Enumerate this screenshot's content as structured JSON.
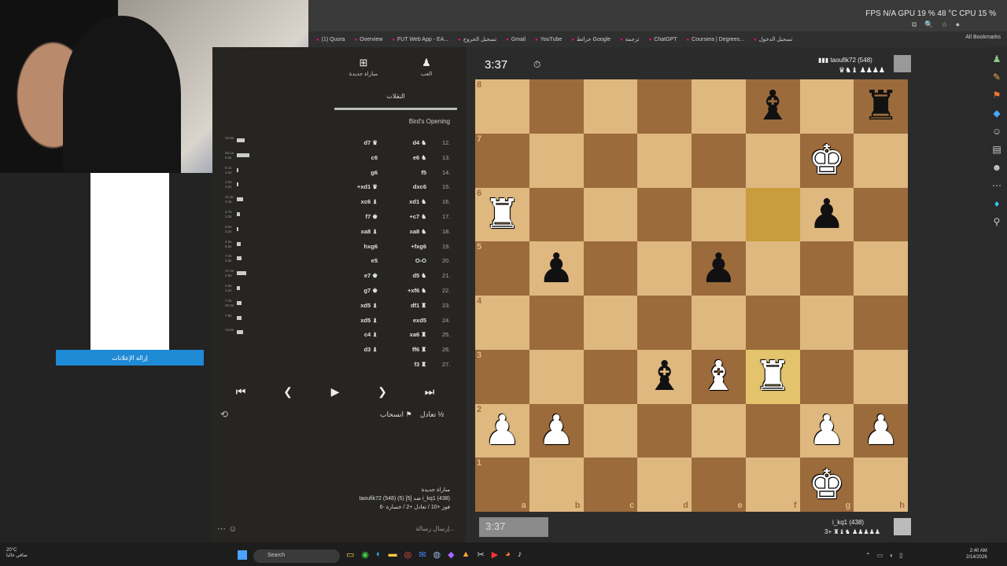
{
  "browser": {
    "stats": "FPS  N/A   GPU  19 %  48 °C   CPU  15 %",
    "bookmarks": [
      "(1) Quora",
      "Overview",
      "FUT Web App - EA...",
      "تسجيل الخروج",
      "Gmail",
      "YouTube",
      "خرائط Google",
      "ترجمة",
      "ChatGPT",
      "Coursera | Degrees...",
      "تسجيل الدخول"
    ],
    "all_bookmarks": "All Bookmarks"
  },
  "ads": {
    "remove_button": "إزالة الإعلانات"
  },
  "panel": {
    "tabs": {
      "new_game": "مباراة جديدة",
      "play": "العب",
      "moves": "النقلات"
    },
    "opening": "Bird's Opening",
    "moves": [
      {
        "num": "12.",
        "w": "d4 ♞",
        "b": "d7 ♛",
        "t1": "34.8s",
        "t2": "",
        "bar": 10
      },
      {
        "num": "13.",
        "w": "e6 ♞",
        "b": "c6",
        "t1": "26.1s",
        "t2": "6.6s",
        "bar": 16
      },
      {
        "num": "14.",
        "w": "f5",
        "b": "g6",
        "t1": "0.1s",
        "t2": "1.0s",
        "bar": 2
      },
      {
        "num": "15.",
        "w": "dxc6",
        "b": "+xd1 ♛",
        "t1": "1.0s",
        "t2": "1.0s",
        "bar": 2
      },
      {
        "num": "16.",
        "w": "xd1 ♞",
        "b": "xc6 ♝",
        "t1": "11.3s",
        "t2": "3.4s",
        "bar": 8
      },
      {
        "num": "17.",
        "w": "+c7 ♞",
        "b": "f7 ♚",
        "t1": "3.7s",
        "t2": "1.0s",
        "bar": 4
      },
      {
        "num": "18.",
        "w": "xa8 ♞",
        "b": "xa8 ♝",
        "t1": "0.5s",
        "t2": "3.2s",
        "bar": 2
      },
      {
        "num": "19.",
        "w": "+fxg6",
        "b": "hxg6",
        "t1": "4.5s",
        "t2": "5.9s",
        "bar": 5
      },
      {
        "num": "20.",
        "w": "O-O",
        "b": "e5",
        "t1": "7.3s",
        "t2": "2.6s",
        "bar": 6
      },
      {
        "num": "21.",
        "w": "d5 ♞",
        "b": "e7 ♚",
        "t1": "17.4s",
        "t2": "4.8s",
        "bar": 12
      },
      {
        "num": "22.",
        "w": "+xf6 ♞",
        "b": "g7 ♚",
        "t1": "4.8s",
        "t2": "1.2s",
        "bar": 4
      },
      {
        "num": "23.",
        "w": "df1 ♜",
        "b": "xd5 ♝",
        "t1": "7.3s",
        "t2": "20.3s",
        "bar": 6
      },
      {
        "num": "24.",
        "w": "exd5",
        "b": "xd5 ♝",
        "t1": "7.8s",
        "t2": "",
        "bar": 6
      },
      {
        "num": "25.",
        "w": "xa6 ♜",
        "b": "c4 ♝",
        "t1": "13.6s",
        "t2": "",
        "bar": 8
      },
      {
        "num": "26.",
        "w": "ff6 ♜",
        "b": "d3 ♝",
        "t1": "",
        "t2": "",
        "bar": 0
      },
      {
        "num": "27.",
        "w": "f3 ♜",
        "b": "",
        "t1": "",
        "t2": "",
        "bar": 0
      }
    ],
    "draw": "تعادل",
    "draw_icon": "½",
    "resign": "انسحاب",
    "game_info": {
      "line1": "مباراة جديدة",
      "line2": "taoufik72 (548) (5) [5] ضد i_kq1 (438)",
      "line3": "فوز +10 / تعادل +2 / خسارة -6"
    },
    "chat_placeholder": "إرسال رسالة..."
  },
  "board": {
    "clock_top": "3:37",
    "clock_bottom": "3:37",
    "player_top": "taoufik72 (548)",
    "player_top_flag": "▮▮▮",
    "player_top_pieces": "♛♞♝ ♟♟♟♟",
    "player_bottom": "i_kq1 (438)",
    "player_bottom_pieces": "3+ ♜♝♞ ♟♟♟♟♟",
    "files": [
      "a",
      "b",
      "c",
      "d",
      "e",
      "f",
      "g",
      "h"
    ],
    "ranks": [
      "8",
      "7",
      "6",
      "5",
      "4",
      "3",
      "2",
      "1"
    ],
    "position": [
      [
        "",
        "",
        "",
        "",
        "",
        "b:♝",
        "",
        "b:♜"
      ],
      [
        "",
        "",
        "",
        "",
        "",
        "",
        "w:♚",
        ""
      ],
      [
        "w:♜",
        "",
        "",
        "",
        "",
        "",
        "b:♟",
        ""
      ],
      [
        "",
        "b:♟",
        "",
        "",
        "b:♟",
        "",
        "",
        ""
      ],
      [
        "",
        "",
        "",
        "",
        "",
        "",
        "",
        ""
      ],
      [
        "",
        "",
        "",
        "b:♝",
        "w:♝",
        "w:♜",
        "",
        ""
      ],
      [
        "w:♟",
        "w:♟",
        "",
        "",
        "",
        "",
        "w:♟",
        "w:♟"
      ],
      [
        "",
        "",
        "",
        "",
        "",
        "",
        "w:♚",
        ""
      ]
    ],
    "highlight": [
      "f6",
      "f3"
    ]
  },
  "taskbar": {
    "weather_temp": "20°C",
    "weather_desc": "صافي غالبا",
    "search": "Search",
    "time": "2:40 AM",
    "date": "2/14/2026"
  }
}
